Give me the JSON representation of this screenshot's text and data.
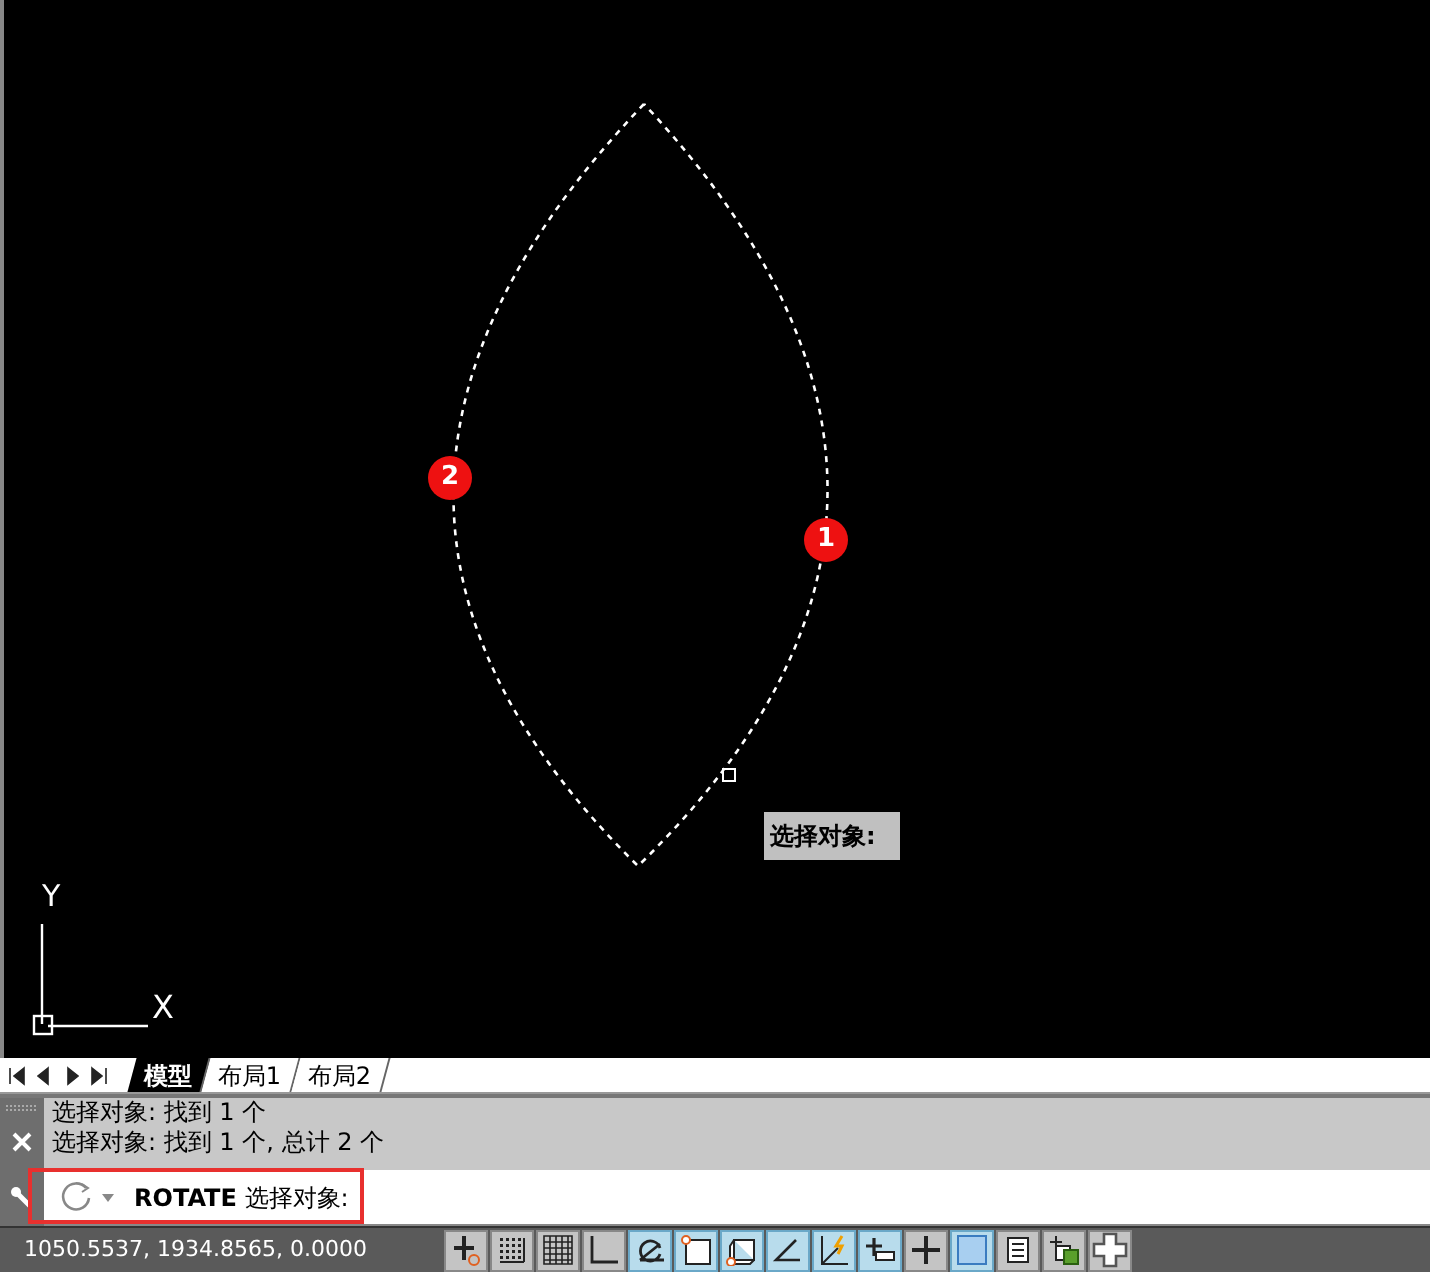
{
  "canvas": {
    "axis_x": "X",
    "axis_y": "Y",
    "markers": [
      "2",
      "1"
    ],
    "tooltip": "选择对象:"
  },
  "layout_tabs": [
    {
      "label": "模型",
      "selected": true
    },
    {
      "label": "布局1",
      "selected": false
    },
    {
      "label": "布局2",
      "selected": false
    }
  ],
  "command_history": [
    "选择对象: 找到 1 个",
    "选择对象: 找到 1 个, 总计 2 个"
  ],
  "command_line": {
    "command": "ROTATE",
    "prompt": "选择对象:"
  },
  "status_bar": {
    "coordinates": "1050.5537, 1934.8565, 0.0000",
    "toggles": [
      {
        "kind": "infer",
        "on": false
      },
      {
        "kind": "snap",
        "on": false
      },
      {
        "kind": "grid",
        "on": false
      },
      {
        "kind": "ortho",
        "on": false
      },
      {
        "kind": "polar",
        "on": true
      },
      {
        "kind": "osnap",
        "on": true
      },
      {
        "kind": "osnap3d",
        "on": true
      },
      {
        "kind": "otrack",
        "on": true
      },
      {
        "kind": "ducs",
        "on": true
      },
      {
        "kind": "dyn",
        "on": true
      },
      {
        "kind": "lwt",
        "on": false
      },
      {
        "kind": "tpy",
        "on": true
      },
      {
        "kind": "qp",
        "on": false
      },
      {
        "kind": "sc",
        "on": false
      },
      {
        "kind": "am",
        "on": false
      }
    ]
  }
}
